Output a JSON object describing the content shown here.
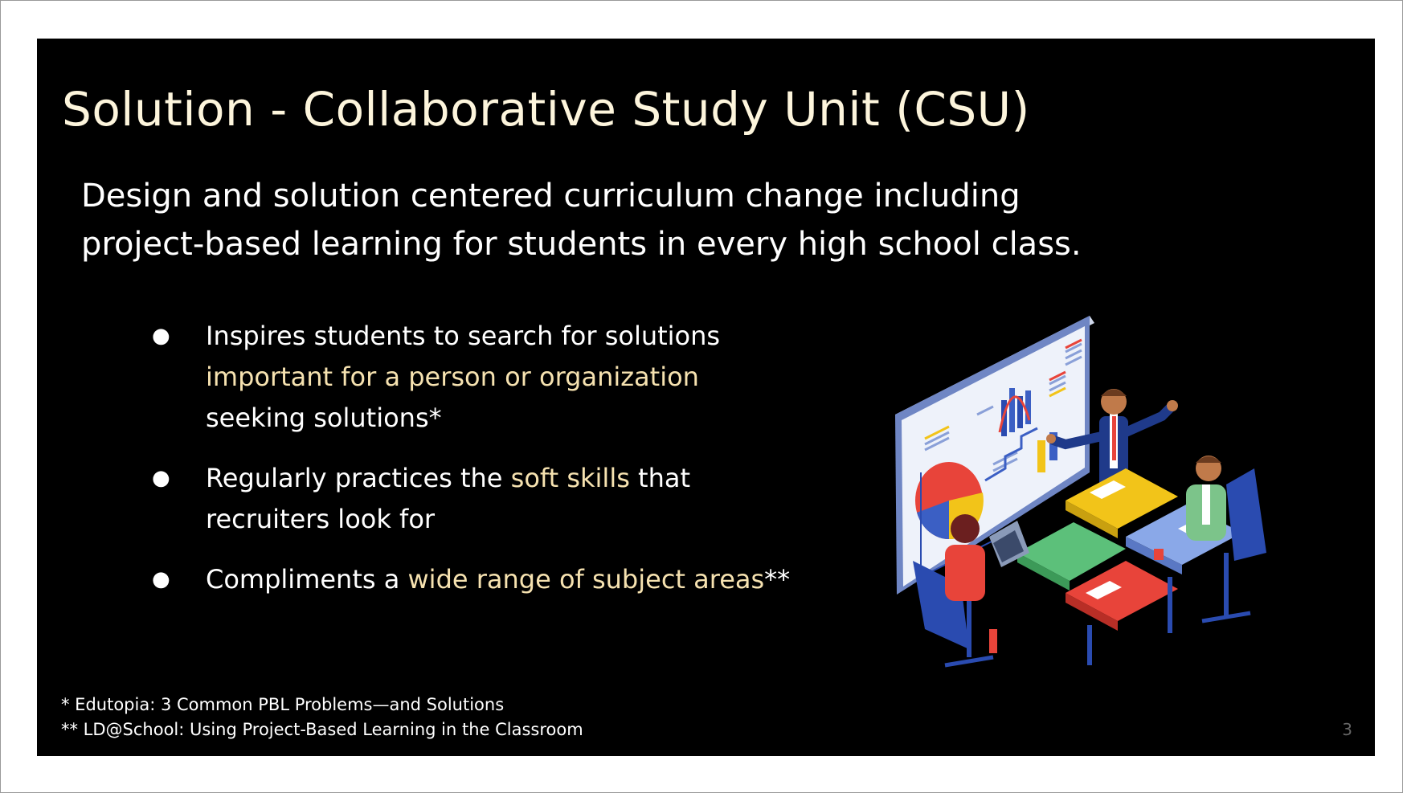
{
  "slide": {
    "title": "Solution - Collaborative Study Unit (CSU)",
    "subtitle_lines": [
      "Design and solution centered curriculum change including",
      "project-based learning for students in every high school class."
    ],
    "bullets": [
      {
        "marker": "●",
        "parts": [
          {
            "text": "Inspires students to search for solutions ",
            "highlight": false
          },
          {
            "text": "important for a person or organization",
            "highlight": true
          },
          {
            "text": " seeking solutions*",
            "highlight": false
          }
        ]
      },
      {
        "marker": "●",
        "parts": [
          {
            "text": "Regularly practices the ",
            "highlight": false
          },
          {
            "text": "soft skills",
            "highlight": true
          },
          {
            "text": " that recruiters look for",
            "highlight": false
          }
        ]
      },
      {
        "marker": "●",
        "parts": [
          {
            "text": "Compliments a ",
            "highlight": false
          },
          {
            "text": "wide range of subject areas",
            "highlight": true
          },
          {
            "text": "**",
            "highlight": false
          }
        ]
      }
    ],
    "footnotes": [
      "* Edutopia: 3 Common PBL Problems—and Solutions",
      "** LD@School: Using Project-Based Learning in the Classroom"
    ],
    "page_number": "3"
  },
  "colors": {
    "background": "#000000",
    "title": "#fdf5dc",
    "text": "#ffffff",
    "highlight": "#f6e2b0",
    "page_number": "#666666"
  },
  "illustration": {
    "icon": "teamwork-presentation-puzzle-illustration"
  }
}
